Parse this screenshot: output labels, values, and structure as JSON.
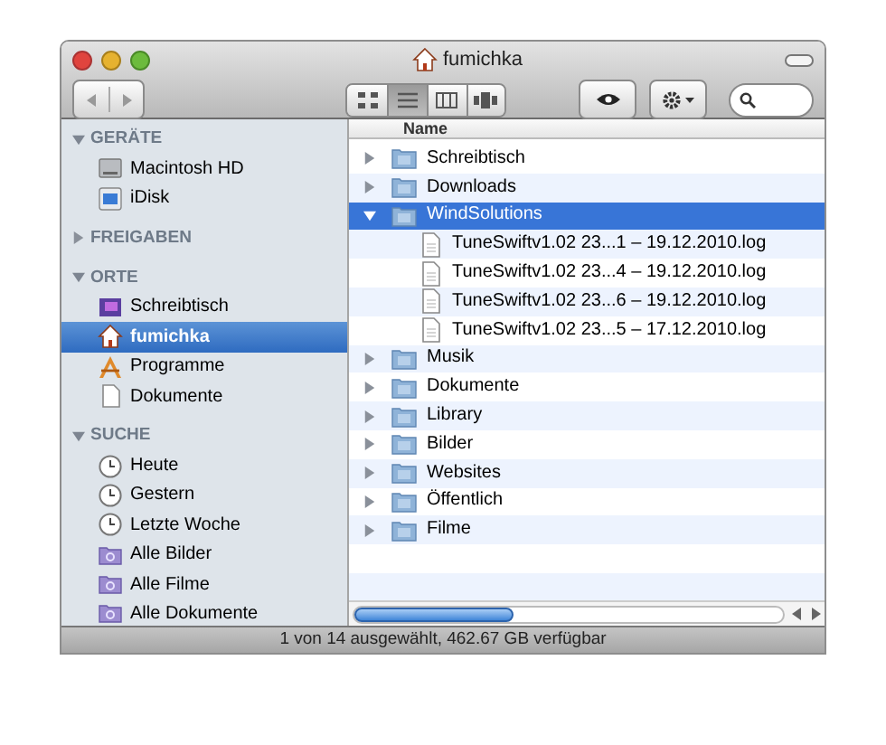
{
  "window": {
    "title": "fumichka"
  },
  "view_modes": [
    {
      "kind": "icons",
      "selected": false
    },
    {
      "kind": "list",
      "selected": true
    },
    {
      "kind": "columns",
      "selected": false
    },
    {
      "kind": "coverflow",
      "selected": false
    }
  ],
  "sidebar": [
    {
      "title": "GERÄTE",
      "expanded": true,
      "items": [
        {
          "label": "Macintosh HD",
          "kind": "disk",
          "selected": false
        },
        {
          "label": "iDisk",
          "kind": "idisk",
          "selected": false
        }
      ]
    },
    {
      "title": "FREIGABEN",
      "expanded": false
    },
    {
      "title": "ORTE",
      "expanded": true,
      "items": [
        {
          "label": "Schreibtisch",
          "kind": "desktop",
          "selected": false
        },
        {
          "label": "fumichka",
          "kind": "home",
          "selected": true
        },
        {
          "label": "Programme",
          "kind": "apps",
          "selected": false
        },
        {
          "label": "Dokumente",
          "kind": "doc",
          "selected": false
        }
      ]
    },
    {
      "title": "SUCHE",
      "expanded": true,
      "items": [
        {
          "label": "Heute",
          "kind": "clock",
          "selected": false
        },
        {
          "label": "Gestern",
          "kind": "clock",
          "selected": false
        },
        {
          "label": "Letzte Woche",
          "kind": "clock",
          "selected": false
        },
        {
          "label": "Alle Bilder",
          "kind": "smartfolder",
          "selected": false
        },
        {
          "label": "Alle Filme",
          "kind": "smartfolder",
          "selected": false
        },
        {
          "label": "Alle Dokumente",
          "kind": "smartfolder",
          "selected": false
        }
      ]
    }
  ],
  "table": {
    "columns": [
      "Name"
    ],
    "rows": [
      {
        "name": "Schreibtisch",
        "kind": "folder",
        "expanded": false,
        "selected": false
      },
      {
        "name": "Downloads",
        "kind": "folder",
        "expanded": false,
        "selected": false
      },
      {
        "name": "WindSolutions",
        "kind": "folder",
        "expanded": true,
        "selected": true,
        "children": [
          {
            "name": "TuneSwiftv1.02 23...1 – 19.12.2010.log",
            "kind": "file",
            "selected": false
          },
          {
            "name": "TuneSwiftv1.02 23...4 – 19.12.2010.log",
            "kind": "file",
            "selected": false
          },
          {
            "name": "TuneSwiftv1.02 23...6 – 19.12.2010.log",
            "kind": "file",
            "selected": false
          },
          {
            "name": "TuneSwiftv1.02 23...5 – 17.12.2010.log",
            "kind": "file",
            "selected": false
          }
        ]
      },
      {
        "name": "Musik",
        "kind": "folder",
        "expanded": false,
        "selected": false
      },
      {
        "name": "Dokumente",
        "kind": "folder",
        "expanded": false,
        "selected": false
      },
      {
        "name": "Library",
        "kind": "folder",
        "expanded": false,
        "selected": false
      },
      {
        "name": "Bilder",
        "kind": "folder",
        "expanded": false,
        "selected": false
      },
      {
        "name": "Websites",
        "kind": "folder",
        "expanded": false,
        "selected": false
      },
      {
        "name": "Öffentlich",
        "kind": "folder",
        "expanded": false,
        "selected": false
      },
      {
        "name": "Filme",
        "kind": "folder",
        "expanded": false,
        "selected": false
      }
    ]
  },
  "status_bar": "1 von 14 ausgewählt, 462.67 GB verfügbar"
}
